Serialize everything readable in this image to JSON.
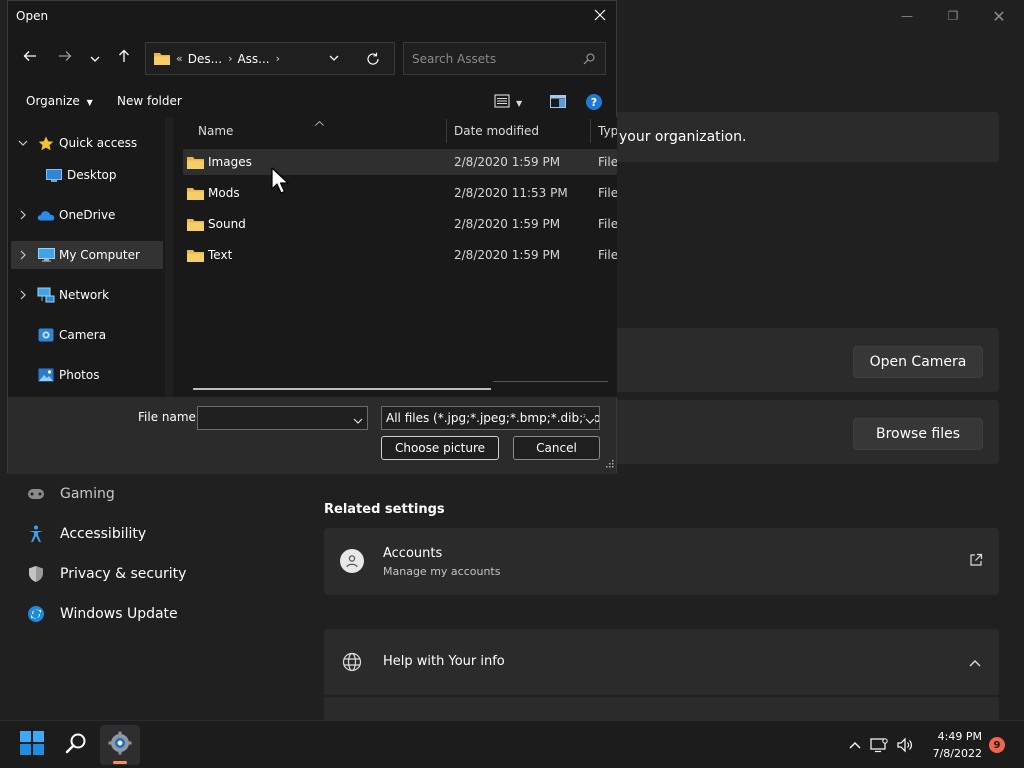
{
  "background": {
    "banner_text": "your organization.",
    "open_camera_label": "Open Camera",
    "browse_files_label": "Browse files",
    "nav": [
      {
        "label": "Gaming",
        "icon": "gamepad-icon"
      },
      {
        "label": "Accessibility",
        "icon": "accessibility-icon"
      },
      {
        "label": "Privacy & security",
        "icon": "shield-icon"
      },
      {
        "label": "Windows Update",
        "icon": "update-icon"
      }
    ],
    "related_settings_title": "Related settings",
    "accounts": {
      "title": "Accounts",
      "subtitle": "Manage my accounts"
    },
    "help": {
      "title": "Help with Your info"
    }
  },
  "dialog": {
    "title": "Open",
    "address": {
      "prefix": "«",
      "crumb1": "Des...",
      "crumb2": "Ass..."
    },
    "search_placeholder": "Search Assets",
    "organize_label": "Organize",
    "new_folder_label": "New folder",
    "tree": [
      {
        "label": "Quick access",
        "icon": "star-icon",
        "expander": "expanded"
      },
      {
        "label": "Desktop",
        "icon": "desktop-icon",
        "expander": "none"
      },
      {
        "label": "OneDrive",
        "icon": "cloud-icon",
        "expander": "collapsed"
      },
      {
        "label": "My Computer",
        "icon": "computer-icon",
        "expander": "collapsed",
        "selected": true
      },
      {
        "label": "Network",
        "icon": "network-icon",
        "expander": "collapsed"
      },
      {
        "label": "Camera",
        "icon": "camera-icon",
        "expander": "none"
      },
      {
        "label": "Photos",
        "icon": "photos-icon",
        "expander": "none"
      }
    ],
    "columns": {
      "name": "Name",
      "date": "Date modified",
      "type": "Type"
    },
    "files": [
      {
        "name": "Images",
        "date": "2/8/2020 1:59 PM",
        "type": "File folder"
      },
      {
        "name": "Mods",
        "date": "2/8/2020 11:53 PM",
        "type": "File folder"
      },
      {
        "name": "Sound",
        "date": "2/8/2020 1:59 PM",
        "type": "File folder"
      },
      {
        "name": "Text",
        "date": "2/8/2020 1:59 PM",
        "type": "File folder"
      }
    ],
    "file_name_label": "File name:",
    "file_name_value": "",
    "filter_value": "All files (*.jpg;*.jpeg;*.bmp;*.dib;*.png",
    "choose_label": "Choose picture",
    "cancel_label": "Cancel"
  },
  "taskbar": {
    "time": "4:49 PM",
    "date": "7/8/2022",
    "notifications": "9"
  },
  "colors": {
    "accent_folder": "#e8b84a",
    "notification": "#f0654f",
    "app_indicator": "#ff8a68"
  }
}
